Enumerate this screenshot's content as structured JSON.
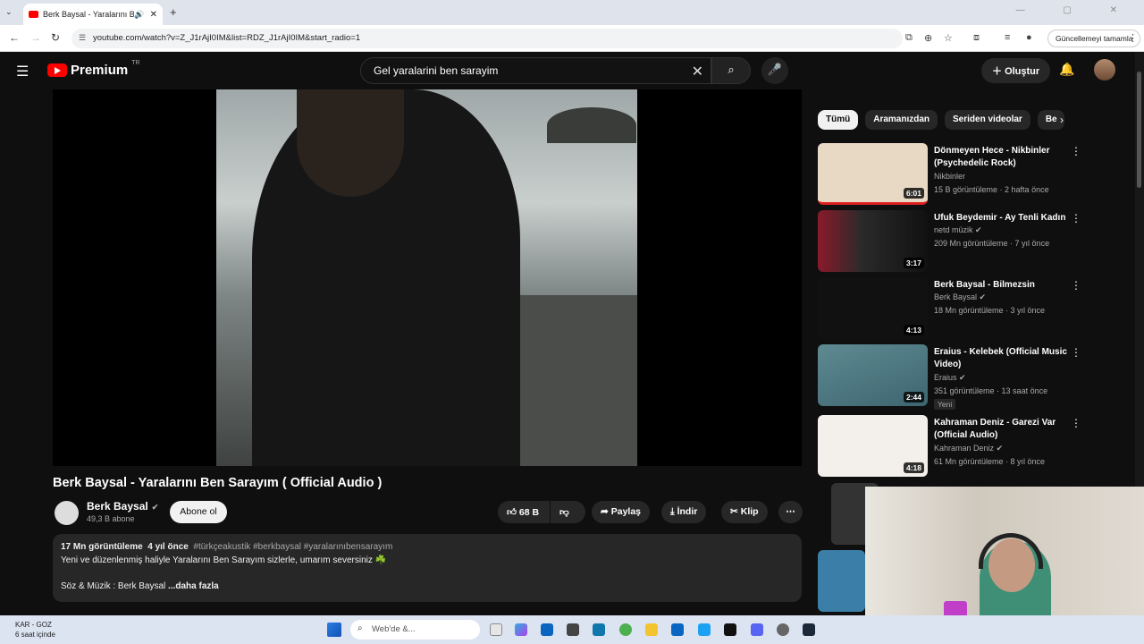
{
  "browser": {
    "tab_title": "Berk Baysal - Yaralarını Ben",
    "url": "youtube.com/watch?v=Z_J1rAjI0IM&list=RDZ_J1rAjI0IM&start_radio=1",
    "update_label": "Güncellemeyi tamamla",
    "window_controls": "— ▢ ✕"
  },
  "youtube": {
    "logo_text": "Premium",
    "region": "TR",
    "search_query": "Gel yaralarini ben sarayim",
    "create_label": "Oluştur"
  },
  "video": {
    "title": "Berk Baysal - Yaralarını Ben Sarayım ( Official Audio )",
    "channel": "Berk Baysal",
    "subscribers": "49,3 B abone",
    "subscribe_label": "Abone ol",
    "likes": "68 B",
    "share_label": "Paylaş",
    "download_label": "İndir",
    "clip_label": "Klip"
  },
  "description": {
    "views": "17 Mn görüntüleme",
    "age": "4 yıl önce",
    "tags": "#türkçeakustik #berkbaysal #yaralarınıbensarayım",
    "line1": "Yeni ve düzenlenmiş haliyle Yaralarını Ben Sarayım sizlerle, umarım seversiniz ☘️",
    "line2": "Söz & Müzik : Berk Baysal",
    "more": "...daha fazla"
  },
  "chips": [
    "Tümü",
    "Aramanızdan",
    "Seriden videolar",
    "Be"
  ],
  "recommendations": [
    {
      "title": "Dönmeyen Hece - Nikbinler (Psychedelic Rock)",
      "channel": "Nikbinler",
      "meta": "15 B görüntüleme · 2 hafta önce",
      "duration": "6:01"
    },
    {
      "title": "Ufuk Beydemir - Ay Tenli Kadın",
      "channel": "netd müzik",
      "meta": "209 Mn görüntüleme · 7 yıl önce",
      "duration": "3:17"
    },
    {
      "title": "Berk Baysal - Bilmezsin",
      "channel": "Berk Baysal",
      "meta": "18 Mn görüntüleme · 3 yıl önce",
      "duration": "4:13"
    },
    {
      "title": "Eraius - Kelebek (Official Music Video)",
      "channel": "Eraius",
      "meta": "351 görüntüleme · 13 saat önce",
      "duration": "2:44",
      "badge": "Yeni"
    },
    {
      "title": "Kahraman Deniz - Garezi Var (Official Audio)",
      "channel": "Kahraman Deniz",
      "meta": "61 Mn görüntüleme · 8 yıl önce",
      "duration": "4:18"
    }
  ],
  "taskbar": {
    "weather_title": "KAR - GOZ",
    "weather_sub": "6 saat içinde",
    "search_placeholder": "Web'de &..."
  }
}
